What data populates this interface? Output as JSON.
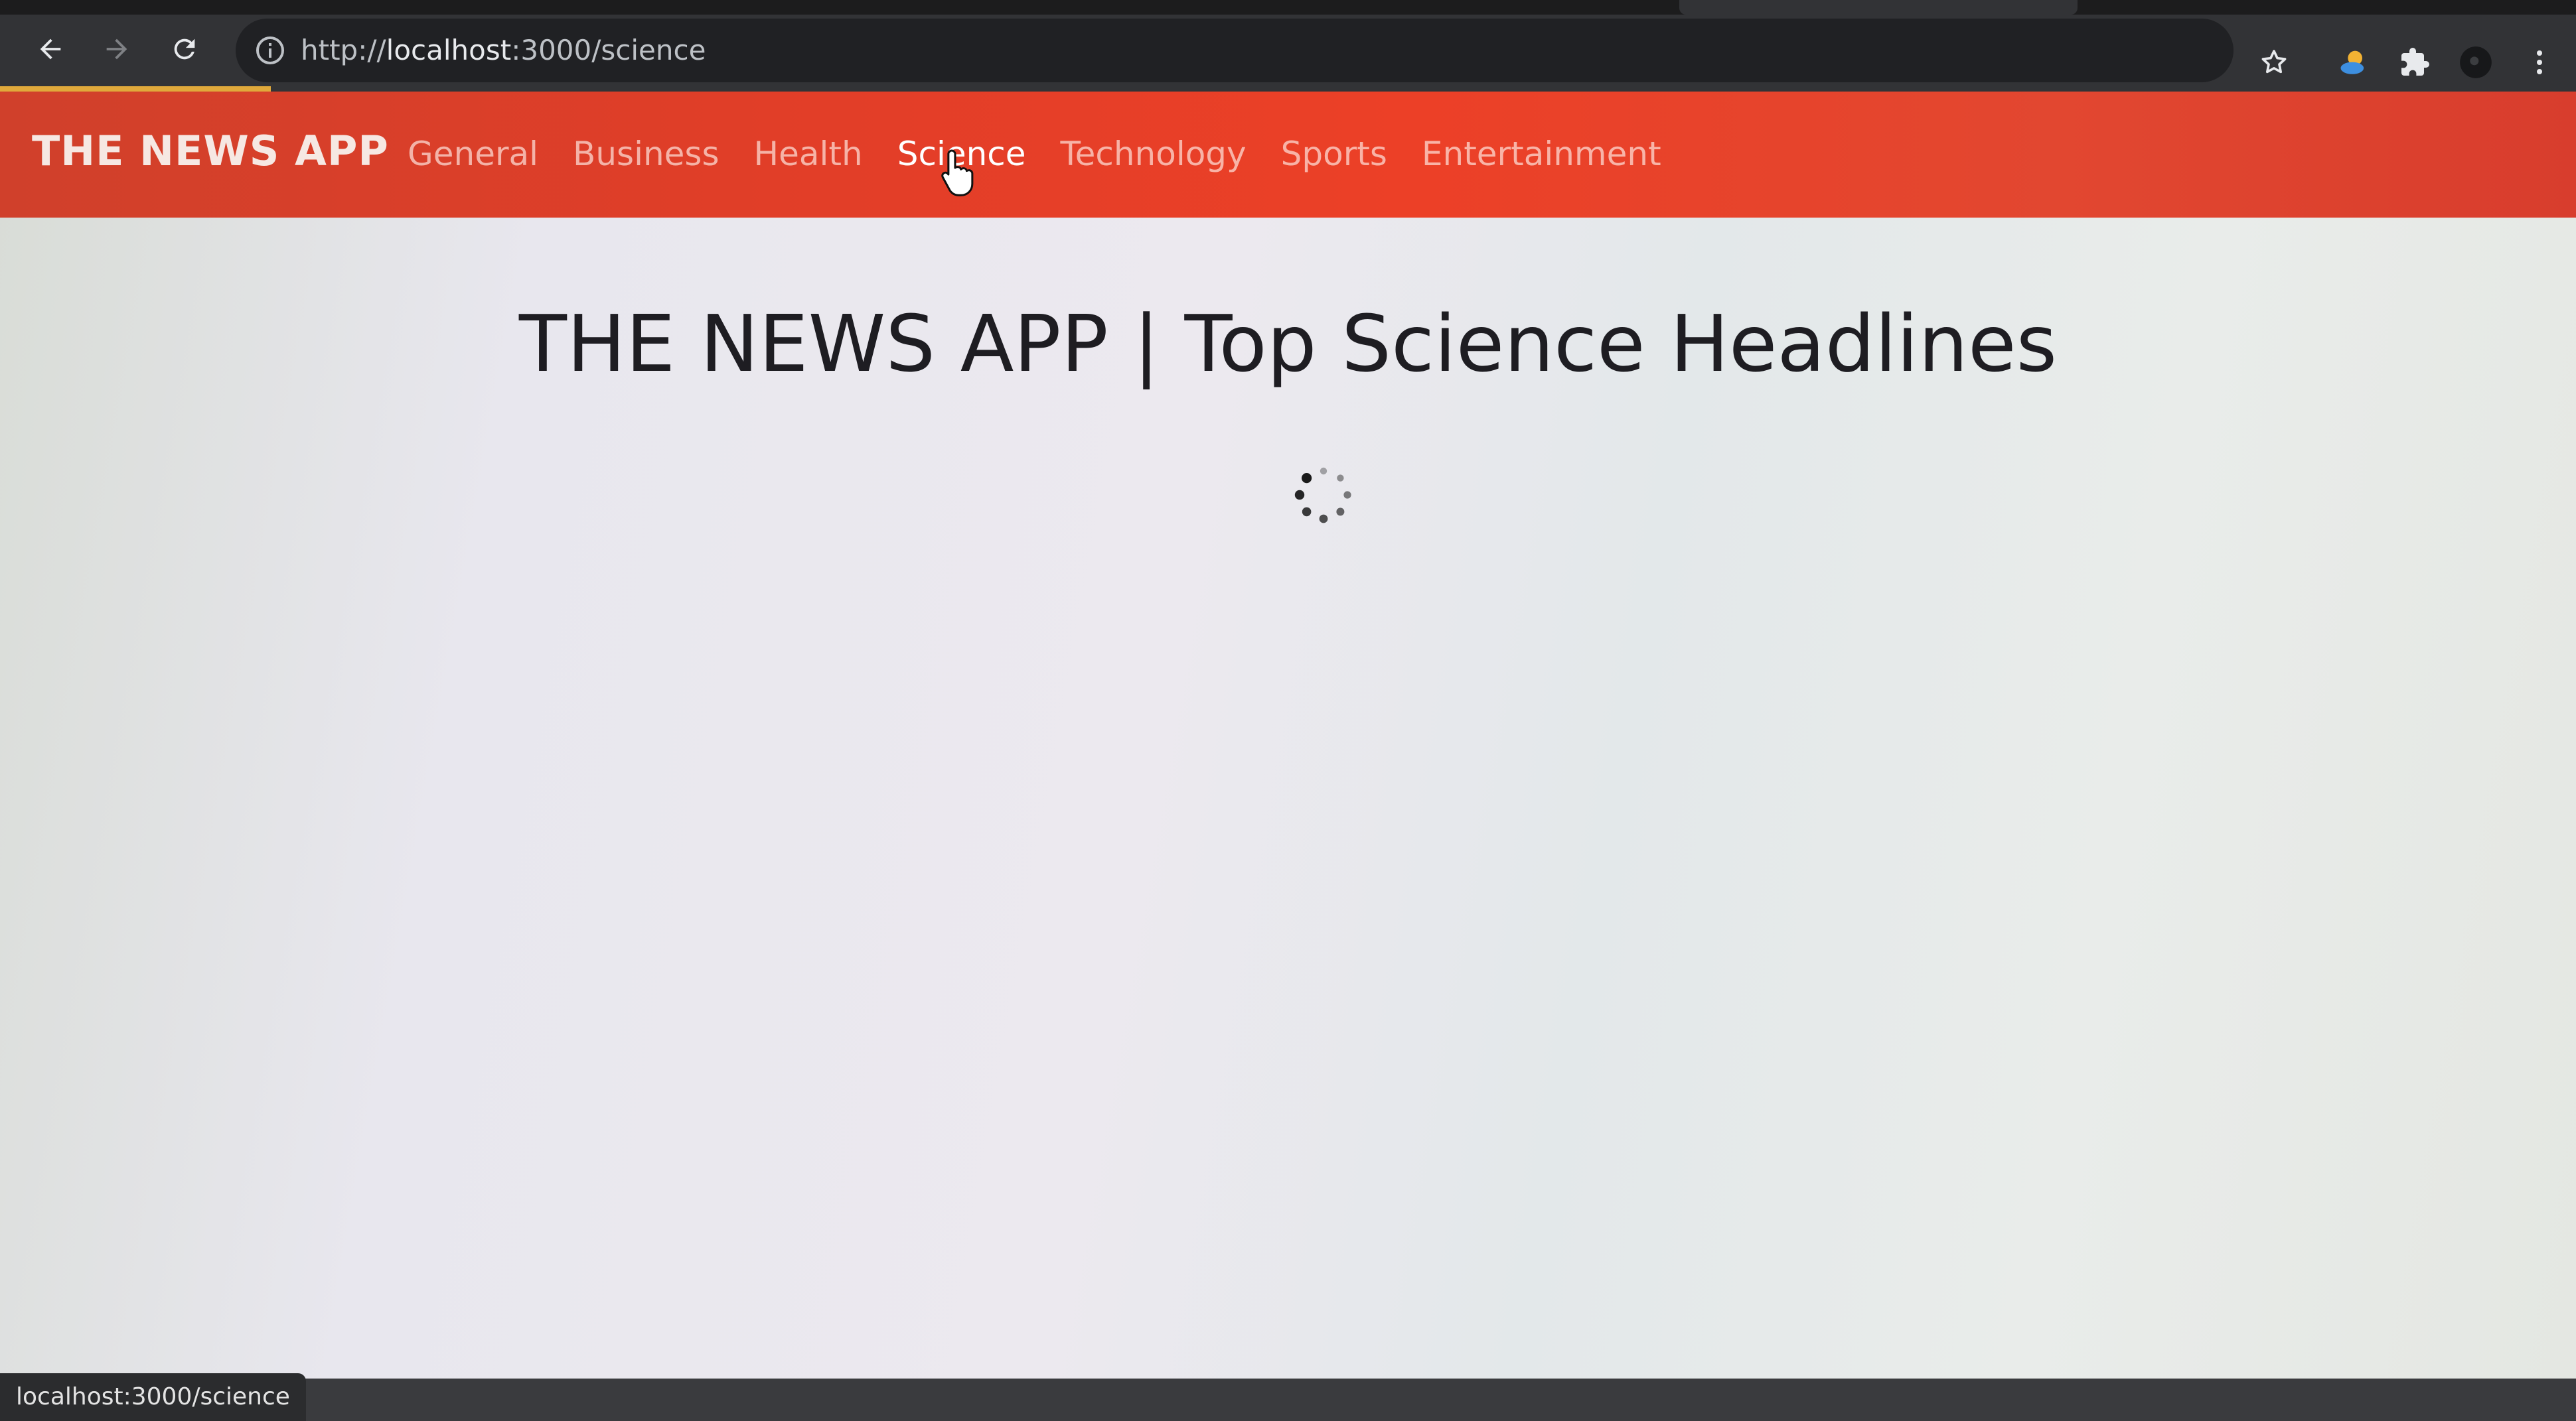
{
  "browser": {
    "url_scheme": "http://",
    "url_host": "localhost",
    "url_rest": ":3000/science",
    "status_url": "localhost:3000/science",
    "icons": [
      "back-icon",
      "forward-icon",
      "reload-icon",
      "info-icon",
      "bookmark-star-icon",
      "weather-extension-icon",
      "extensions-puzzle-icon",
      "profile-avatar",
      "menu-kebab-icon"
    ]
  },
  "navbar": {
    "brand": "THE NEWS APP",
    "links": [
      "General",
      "Business",
      "Health",
      "Science",
      "Technology",
      "Sports",
      "Entertainment"
    ],
    "active": "Science",
    "color": "#e13e28"
  },
  "main": {
    "headline": "THE NEWS APP | Top Science Headlines",
    "loading": true
  }
}
